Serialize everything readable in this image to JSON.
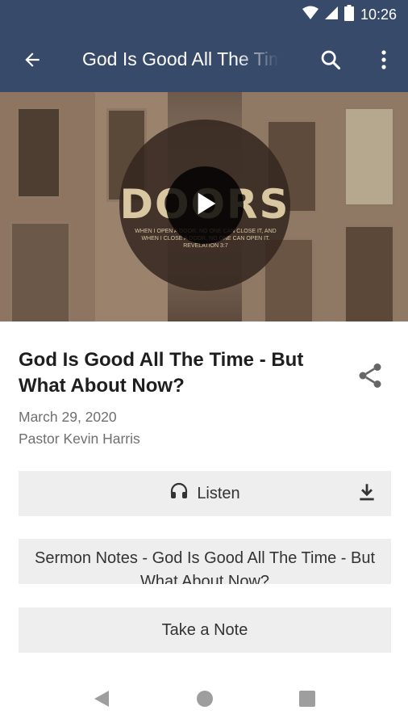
{
  "status_bar": {
    "time": "10:26",
    "icons": [
      "wifi-icon",
      "cellular-signal-icon",
      "battery-icon"
    ]
  },
  "app_bar": {
    "title": "God Is Good All The Time - But What About Now?",
    "back_icon": "arrow-left-icon",
    "search_icon": "search-icon",
    "more_icon": "more-vertical-icon",
    "color": "#384a6a"
  },
  "video": {
    "artwork_title": "DOORS",
    "artwork_verse": "WHEN I OPEN A DOOR, NO ONE CAN CLOSE IT, AND WHEN I CLOSE A DOOR, NO ONE CAN OPEN IT. REVELATION 3:7",
    "play_icon": "play-icon"
  },
  "sermon": {
    "title": "God Is Good All The Time - But What About Now?",
    "date": "March 29, 2020",
    "speaker": "Pastor Kevin Harris",
    "share_icon": "share-icon"
  },
  "actions": {
    "listen_label": "Listen",
    "listen_icon": "headphones-icon",
    "download_icon": "download-icon",
    "notes_label": "Sermon Notes - God Is Good All The Time - But What About Now?",
    "take_note_label": "Take a Note"
  },
  "nav_bar": {
    "icons": [
      "back-triangle-icon",
      "home-circle-icon",
      "recents-square-icon"
    ]
  }
}
